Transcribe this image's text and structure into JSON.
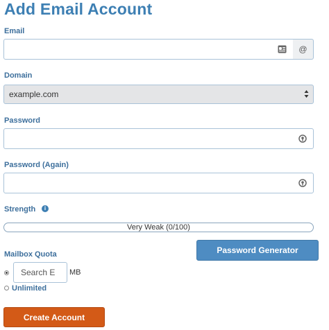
{
  "header": {
    "title": "Add Email Account"
  },
  "email": {
    "label": "Email",
    "value": "",
    "addon": "@"
  },
  "domain": {
    "label": "Domain",
    "selected": "example.com"
  },
  "password": {
    "label": "Password",
    "value": ""
  },
  "password_again": {
    "label": "Password (Again)",
    "value": ""
  },
  "strength": {
    "label": "Strength",
    "meter_text": "Very Weak (0/100)",
    "score": 0,
    "max": 100
  },
  "password_generator": {
    "label": "Password Generator"
  },
  "quota": {
    "label": "Mailbox Quota",
    "placeholder": "Search E",
    "unit": "MB",
    "unlimited_label": "Unlimited",
    "selected_option": "custom"
  },
  "actions": {
    "create_label": "Create Account"
  },
  "colors": {
    "heading": "#3d7fb3",
    "label": "#3d6f9c",
    "primary_button": "#4e8cc2",
    "create_button": "#d35a17",
    "select_bg": "#e4e5e7"
  },
  "icons": {
    "email_field": "contact-card-icon",
    "password_field": "key-icon",
    "strength_info": "info-icon"
  }
}
